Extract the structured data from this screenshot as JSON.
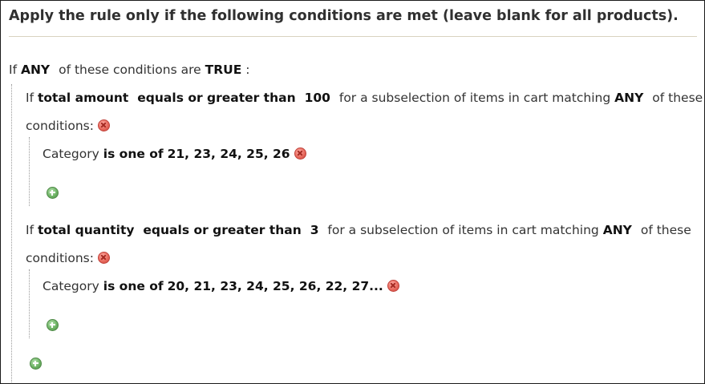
{
  "heading": "Apply the rule only if the following conditions are met (leave blank for all products).",
  "root": {
    "prefix": "If",
    "aggregator": "ANY",
    "middle": "of these conditions are",
    "value": "TRUE",
    "suffix": ":"
  },
  "conditions": [
    {
      "prefix": "If",
      "attribute": "total amount",
      "operator": "equals or greater than",
      "value": "100",
      "middle": "for a subselection of items in cart matching",
      "aggregator": "ANY",
      "suffix": "of these",
      "line2": "conditions:",
      "sub": {
        "attribute": "Category",
        "operator": "is one of",
        "value": "21, 23, 24, 25, 26"
      }
    },
    {
      "prefix": "If",
      "attribute": "total quantity",
      "operator": "equals or greater than",
      "value": "3",
      "middle": "for a subselection of items in cart matching",
      "aggregator": "ANY",
      "suffix": "of these",
      "line2": "conditions:",
      "sub": {
        "attribute": "Category",
        "operator": "is one of",
        "value": "20, 21, 23, 24, 25, 26, 22, 27..."
      }
    }
  ],
  "icons": {
    "remove": "remove-circle-icon",
    "add": "add-circle-icon"
  },
  "colors": {
    "remove_red": "#e86a5e",
    "add_green": "#6fb466",
    "rule_line": "#d8d2c0"
  }
}
